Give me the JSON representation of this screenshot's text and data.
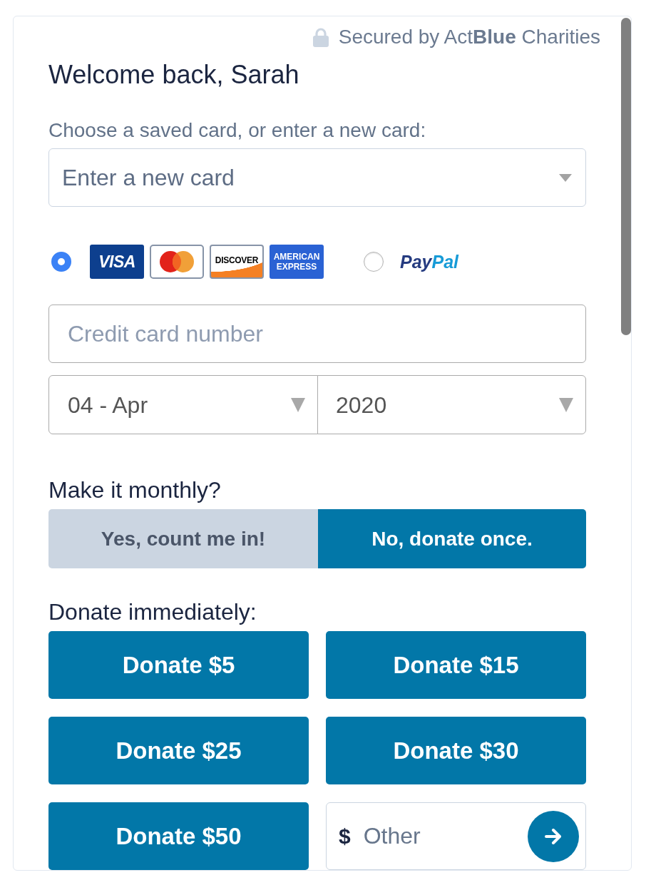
{
  "security_note": {
    "text": "Secured by Act**Blue** Charities"
  },
  "greeting": "Welcome back, Sarah",
  "saved_card": {
    "label": "Choose a saved card, or enter a new card:",
    "value": "Enter a new card"
  },
  "payment_methods": [
    {
      "kind": "cards",
      "selected": true,
      "logos": [
        {
          "kind": "visa",
          "text": "VISA"
        },
        {
          "kind": "mastercard"
        },
        {
          "kind": "discover",
          "text": "DISCOVER"
        },
        {
          "kind": "amex",
          "text": "AMERICAN EXPRESS"
        }
      ]
    },
    {
      "kind": "paypal",
      "selected": false,
      "logos": [
        {
          "kind": "paypal",
          "parts": [
            "Pay",
            "Pal"
          ]
        }
      ]
    }
  ],
  "card_number": {
    "placeholder": "Credit card number"
  },
  "expiry": {
    "month": "04 - Apr",
    "year": "2020"
  },
  "monthly": {
    "label": "Make it monthly?",
    "options": [
      {
        "label": "Yes, count me in!",
        "selected": false
      },
      {
        "label": "No, donate once.",
        "selected": true
      }
    ]
  },
  "donate": {
    "label": "Donate immediately:",
    "amounts": [
      "Donate $5",
      "Donate $15",
      "Donate $25",
      "Donate $30",
      "Donate $50"
    ],
    "other": {
      "currency": "$",
      "placeholder": "Other"
    }
  }
}
